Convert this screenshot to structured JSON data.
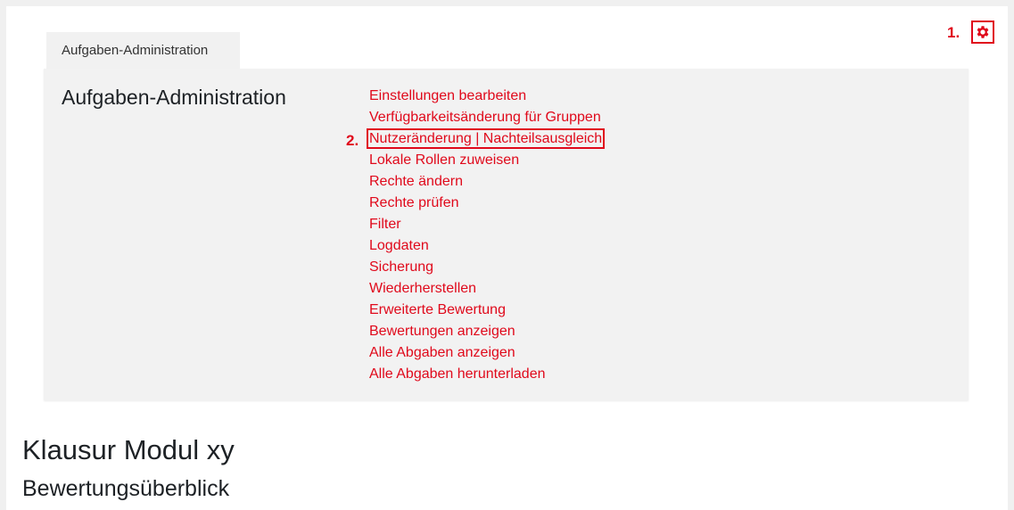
{
  "annotations": {
    "step1": "1.",
    "step2": "2."
  },
  "header": {
    "settings_icon": "gear-icon"
  },
  "tab": {
    "label": "Aufgaben-Administration"
  },
  "panel": {
    "title": "Aufgaben-Administration",
    "menu_items": [
      "Einstellungen bearbeiten",
      "Verfügbarkeitsänderung für Gruppen",
      "Nutzeränderung | Nachteilsausgleich",
      "Lokale Rollen zuweisen",
      "Rechte ändern",
      "Rechte prüfen",
      "Filter",
      "Logdaten",
      "Sicherung",
      "Wiederherstellen",
      "Erweiterte Bewertung",
      "Bewertungen anzeigen",
      "Alle Abgaben anzeigen",
      "Alle Abgaben herunterladen"
    ]
  },
  "page": {
    "title": "Klausur Modul xy",
    "subtitle": "Bewertungsüberblick"
  },
  "colors": {
    "accent": "#e0091b",
    "panel_bg": "#f2f2f2"
  }
}
